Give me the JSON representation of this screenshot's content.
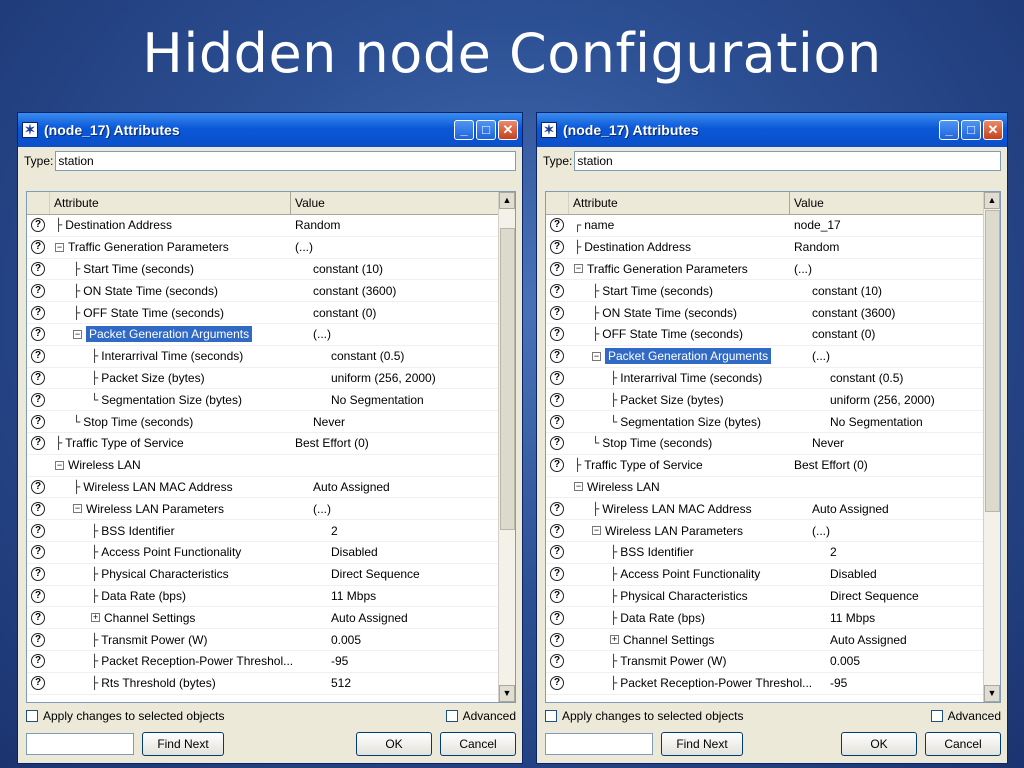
{
  "slide": {
    "title": "Hidden node Configuration"
  },
  "windows": [
    {
      "title": "(node_17) Attributes",
      "type_label": "Type:",
      "type_value": "station",
      "col_attr": "Attribute",
      "col_val": "Value",
      "rows": [
        {
          "attr": "Destination Address",
          "val": "Random",
          "depth": 0,
          "branch": "├",
          "exp": "",
          "help": true,
          "sel": false
        },
        {
          "attr": "Traffic Generation Parameters",
          "val": "(...)",
          "depth": 0,
          "branch": "",
          "exp": "−",
          "help": true,
          "sel": false
        },
        {
          "attr": "Start Time (seconds)",
          "val": "constant (10)",
          "depth": 1,
          "branch": "├",
          "exp": "",
          "help": true,
          "sel": false
        },
        {
          "attr": "ON State Time (seconds)",
          "val": "constant (3600)",
          "depth": 1,
          "branch": "├",
          "exp": "",
          "help": true,
          "sel": false
        },
        {
          "attr": "OFF State Time (seconds)",
          "val": "constant (0)",
          "depth": 1,
          "branch": "├",
          "exp": "",
          "help": true,
          "sel": false
        },
        {
          "attr": "Packet Generation Arguments",
          "val": "(...)",
          "depth": 1,
          "branch": "",
          "exp": "−",
          "help": true,
          "sel": true
        },
        {
          "attr": "Interarrival Time (seconds)",
          "val": "constant (0.5)",
          "depth": 2,
          "branch": "├",
          "exp": "",
          "help": true,
          "sel": false
        },
        {
          "attr": "Packet Size (bytes)",
          "val": "uniform (256, 2000)",
          "depth": 2,
          "branch": "├",
          "exp": "",
          "help": true,
          "sel": false
        },
        {
          "attr": "Segmentation Size (bytes)",
          "val": "No Segmentation",
          "depth": 2,
          "branch": "└",
          "exp": "",
          "help": true,
          "sel": false
        },
        {
          "attr": "Stop Time (seconds)",
          "val": "Never",
          "depth": 1,
          "branch": "└",
          "exp": "",
          "help": true,
          "sel": false
        },
        {
          "attr": "Traffic Type of Service",
          "val": "Best Effort (0)",
          "depth": 0,
          "branch": "├",
          "exp": "",
          "help": true,
          "sel": false
        },
        {
          "attr": "Wireless LAN",
          "val": "",
          "depth": 0,
          "branch": "",
          "exp": "−",
          "help": false,
          "sel": false
        },
        {
          "attr": "Wireless LAN MAC Address",
          "val": "Auto Assigned",
          "depth": 1,
          "branch": "├",
          "exp": "",
          "help": true,
          "sel": false
        },
        {
          "attr": "Wireless LAN Parameters",
          "val": "(...)",
          "depth": 1,
          "branch": "",
          "exp": "−",
          "help": true,
          "sel": false
        },
        {
          "attr": "BSS Identifier",
          "val": "2",
          "depth": 2,
          "branch": "├",
          "exp": "",
          "help": true,
          "sel": false
        },
        {
          "attr": "Access Point Functionality",
          "val": "Disabled",
          "depth": 2,
          "branch": "├",
          "exp": "",
          "help": true,
          "sel": false
        },
        {
          "attr": "Physical Characteristics",
          "val": "Direct Sequence",
          "depth": 2,
          "branch": "├",
          "exp": "",
          "help": true,
          "sel": false
        },
        {
          "attr": "Data Rate (bps)",
          "val": "11 Mbps",
          "depth": 2,
          "branch": "├",
          "exp": "",
          "help": true,
          "sel": false
        },
        {
          "attr": "Channel Settings",
          "val": "Auto Assigned",
          "depth": 2,
          "branch": "",
          "exp": "+",
          "help": true,
          "sel": false
        },
        {
          "attr": "Transmit Power (W)",
          "val": "0.005",
          "depth": 2,
          "branch": "├",
          "exp": "",
          "help": true,
          "sel": false
        },
        {
          "attr": "Packet Reception-Power Threshol...",
          "val": "-95",
          "depth": 2,
          "branch": "├",
          "exp": "",
          "help": true,
          "sel": false
        },
        {
          "attr": "Rts Threshold (bytes)",
          "val": "512",
          "depth": 2,
          "branch": "├",
          "exp": "",
          "help": true,
          "sel": false
        }
      ],
      "apply_label": "Apply changes to selected objects",
      "advanced_label": "Advanced",
      "find_next": "Find Next",
      "ok": "OK",
      "cancel": "Cancel"
    },
    {
      "title": "(node_17) Attributes",
      "type_label": "Type:",
      "type_value": "station",
      "col_attr": "Attribute",
      "col_val": "Value",
      "rows": [
        {
          "attr": "name",
          "val": "node_17",
          "depth": 0,
          "branch": "┌",
          "exp": "",
          "help": true,
          "sel": false
        },
        {
          "attr": "Destination Address",
          "val": "Random",
          "depth": 0,
          "branch": "├",
          "exp": "",
          "help": true,
          "sel": false
        },
        {
          "attr": "Traffic Generation Parameters",
          "val": "(...)",
          "depth": 0,
          "branch": "",
          "exp": "−",
          "help": true,
          "sel": false
        },
        {
          "attr": "Start Time (seconds)",
          "val": "constant (10)",
          "depth": 1,
          "branch": "├",
          "exp": "",
          "help": true,
          "sel": false
        },
        {
          "attr": "ON State Time (seconds)",
          "val": "constant (3600)",
          "depth": 1,
          "branch": "├",
          "exp": "",
          "help": true,
          "sel": false
        },
        {
          "attr": "OFF State Time (seconds)",
          "val": "constant (0)",
          "depth": 1,
          "branch": "├",
          "exp": "",
          "help": true,
          "sel": false
        },
        {
          "attr": "Packet Generation Arguments",
          "val": "(...)",
          "depth": 1,
          "branch": "",
          "exp": "−",
          "help": true,
          "sel": true
        },
        {
          "attr": "Interarrival Time (seconds)",
          "val": "constant (0.5)",
          "depth": 2,
          "branch": "├",
          "exp": "",
          "help": true,
          "sel": false
        },
        {
          "attr": "Packet Size (bytes)",
          "val": "uniform (256, 2000)",
          "depth": 2,
          "branch": "├",
          "exp": "",
          "help": true,
          "sel": false
        },
        {
          "attr": "Segmentation Size (bytes)",
          "val": "No Segmentation",
          "depth": 2,
          "branch": "└",
          "exp": "",
          "help": true,
          "sel": false
        },
        {
          "attr": "Stop Time (seconds)",
          "val": "Never",
          "depth": 1,
          "branch": "└",
          "exp": "",
          "help": true,
          "sel": false
        },
        {
          "attr": "Traffic Type of Service",
          "val": "Best Effort (0)",
          "depth": 0,
          "branch": "├",
          "exp": "",
          "help": true,
          "sel": false
        },
        {
          "attr": "Wireless LAN",
          "val": "",
          "depth": 0,
          "branch": "",
          "exp": "−",
          "help": false,
          "sel": false
        },
        {
          "attr": "Wireless LAN MAC Address",
          "val": "Auto Assigned",
          "depth": 1,
          "branch": "├",
          "exp": "",
          "help": true,
          "sel": false
        },
        {
          "attr": "Wireless LAN Parameters",
          "val": "(...)",
          "depth": 1,
          "branch": "",
          "exp": "−",
          "help": true,
          "sel": false
        },
        {
          "attr": "BSS Identifier",
          "val": "2",
          "depth": 2,
          "branch": "├",
          "exp": "",
          "help": true,
          "sel": false
        },
        {
          "attr": "Access Point Functionality",
          "val": "Disabled",
          "depth": 2,
          "branch": "├",
          "exp": "",
          "help": true,
          "sel": false
        },
        {
          "attr": "Physical Characteristics",
          "val": "Direct Sequence",
          "depth": 2,
          "branch": "├",
          "exp": "",
          "help": true,
          "sel": false
        },
        {
          "attr": "Data Rate (bps)",
          "val": "11 Mbps",
          "depth": 2,
          "branch": "├",
          "exp": "",
          "help": true,
          "sel": false
        },
        {
          "attr": "Channel Settings",
          "val": "Auto Assigned",
          "depth": 2,
          "branch": "",
          "exp": "+",
          "help": true,
          "sel": false
        },
        {
          "attr": "Transmit Power (W)",
          "val": "0.005",
          "depth": 2,
          "branch": "├",
          "exp": "",
          "help": true,
          "sel": false
        },
        {
          "attr": "Packet Reception-Power Threshol...",
          "val": "-95",
          "depth": 2,
          "branch": "├",
          "exp": "",
          "help": true,
          "sel": false
        }
      ],
      "apply_label": "Apply changes to selected objects",
      "advanced_label": "Advanced",
      "find_next": "Find Next",
      "ok": "OK",
      "cancel": "Cancel"
    }
  ],
  "colors": {
    "titlebar": "#0a58d8",
    "selection": "#316ac5",
    "background": "#2c4f93"
  },
  "icons": {
    "help": "question-icon",
    "minimize": "minimize-icon",
    "maximize": "maximize-icon",
    "close": "close-icon",
    "app": "app-icon"
  }
}
